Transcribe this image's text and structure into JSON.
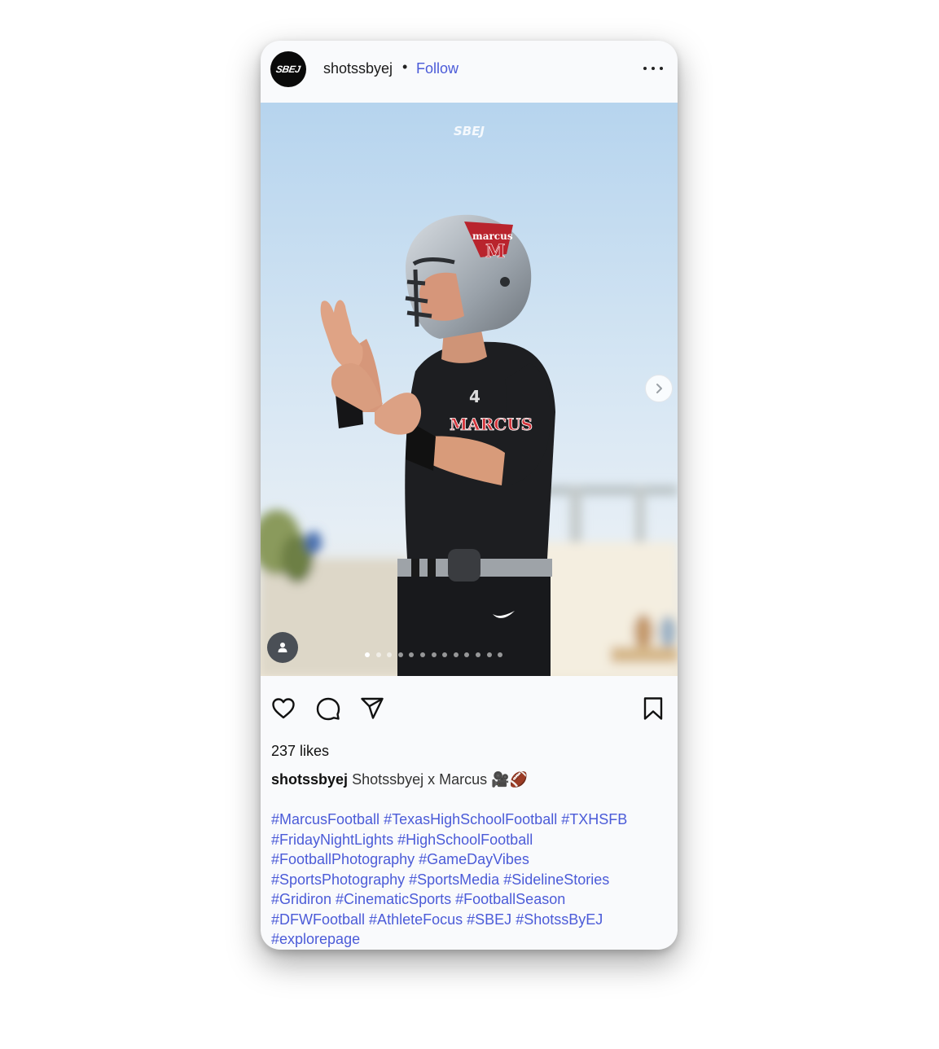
{
  "post": {
    "username": "shotssbyej",
    "follow_label": "Follow",
    "avatar_text": "SBEJ",
    "watermark": "SBEJ",
    "carousel": {
      "total_slides": 13,
      "active_slide": 1
    },
    "likes_text": "237 likes",
    "caption_user": "shotssbyej",
    "caption_text": "Shotssbyej x Marcus 🎥🏈",
    "hashtags": [
      "#MarcusFootball",
      "#TexasHighSchoolFootball",
      "#TXHSFB",
      "#FridayNightLights",
      "#HighSchoolFootball",
      "#FootballPhotography",
      "#GameDayVibes",
      "#SportsPhotography",
      "#SportsMedia",
      "#SidelineStories",
      "#Gridiron",
      "#CinematicSports",
      "#FootballSeason",
      "#DFWFootball",
      "#AthleteFocus",
      "#SBEJ",
      "#ShotssByEJ",
      "#explorepage"
    ],
    "hashtag_lines": [
      [
        0,
        1,
        2
      ],
      [
        3,
        4
      ],
      [
        5,
        6
      ],
      [
        7,
        8,
        9
      ],
      [
        10,
        11,
        12
      ],
      [
        13,
        14,
        15,
        16
      ],
      [
        17
      ]
    ],
    "photo": {
      "helmet_text": "marcus",
      "helmet_letter": "M",
      "jersey_text": "MARCUS",
      "jersey_number": "4"
    }
  },
  "colors": {
    "link": "#4b5bd8",
    "text": "#111111",
    "card_bg": "#f9fafc"
  },
  "icons": [
    "more-icon",
    "chevron-right-icon",
    "user-tag-icon",
    "heart-icon",
    "comment-icon",
    "share-icon",
    "bookmark-icon"
  ]
}
